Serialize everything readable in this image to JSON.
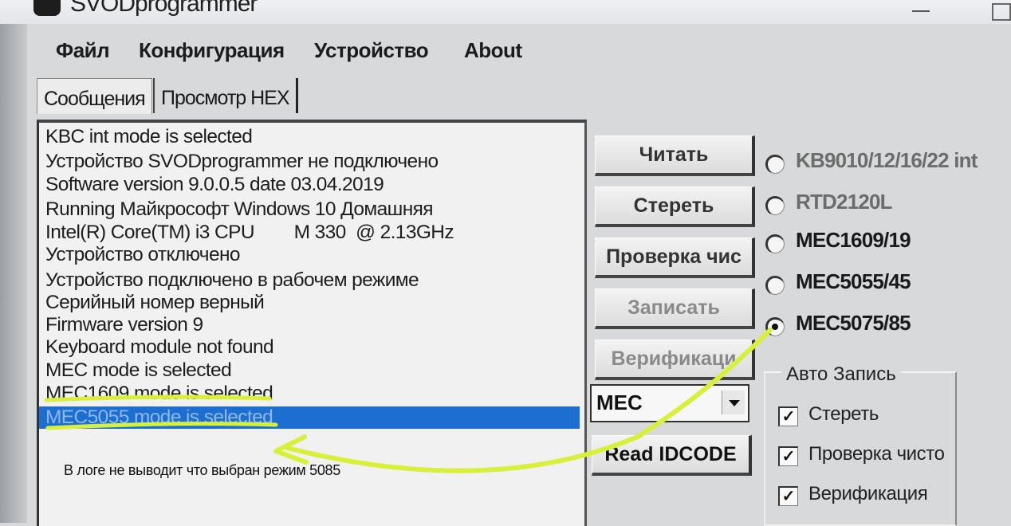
{
  "window": {
    "title": "SVODprogrammer"
  },
  "menu": [
    "Файл",
    "Конфигурация",
    "Устройство",
    "About"
  ],
  "tabs": [
    "Сообщения",
    "Просмотр HEX"
  ],
  "log": [
    "KBC int mode is selected",
    "Устройство SVODprogrammer не подключено",
    "Software version 9.0.0.5 date 03.04.2019",
    "Running Майкрософт Windows 10 Домашняя",
    "Intel(R) Core(TM) i3 CPU        M 330  @ 2.13GHz",
    "Устройство отключено",
    "Устройство подключено в рабочем режиме",
    "Серийный номер верный",
    "Firmware version 9",
    "Keyboard module not found",
    "MEC mode is selected",
    "MEC1609 mode is selected",
    "MEC5055 mode is selected"
  ],
  "buttons": {
    "read": "Читать",
    "erase": "Стереть",
    "blank_check": "Проверка чис",
    "write": "Записать",
    "verify": "Верификаци",
    "read_idcode": "Read IDCODE"
  },
  "combo": {
    "value": "MEC"
  },
  "chips": [
    {
      "label": "KB9010/12/16/22 int",
      "checked": false
    },
    {
      "label": "RTD2120L",
      "checked": false
    },
    {
      "label": "MEC1609/19",
      "checked": false
    },
    {
      "label": "MEC5055/45",
      "checked": false
    },
    {
      "label": "MEC5075/85",
      "checked": true
    }
  ],
  "auto_write": {
    "title": "Авто Запись",
    "items": [
      {
        "label": "Стереть",
        "checked": true
      },
      {
        "label": "Проверка чисто",
        "checked": true
      },
      {
        "label": "Верификация",
        "checked": true
      }
    ]
  },
  "annotation": {
    "note": "В логе не выводит что выбран режим 5085",
    "color": "#d8f03a"
  }
}
